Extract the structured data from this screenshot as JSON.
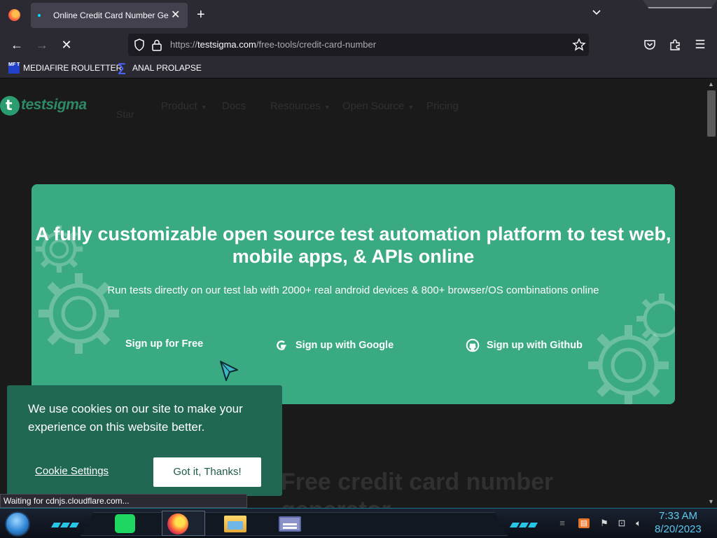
{
  "browser": {
    "tab_title": "Online Credit Card Number Ger",
    "url_domain": "testsigma.com",
    "url_path": "/free-tools/credit-card-number",
    "url_prefix": "https://",
    "bookmarks": [
      {
        "label": "MEDIAFIRE ROULETTER",
        "icon": "mediafire-icon"
      },
      {
        "label": "ANAL PROLAPSE",
        "icon": "bookmark-sigma-icon"
      }
    ],
    "status_text": "Waiting for cdnjs.cloudflare.com..."
  },
  "site": {
    "logo_text": "testsigma",
    "nav": [
      {
        "label": "Product",
        "dropdown": true
      },
      {
        "label": "Docs",
        "dropdown": false
      },
      {
        "label": "Resources",
        "dropdown": true
      },
      {
        "label": "Open Source",
        "dropdown": true
      },
      {
        "label": "Pricing",
        "dropdown": false
      }
    ],
    "nav_star": "Star",
    "hero": {
      "title": "A fully customizable open source test automation platform to test web, mobile apps, & APIs online",
      "subtitle": "Run tests directly on our test lab with 2000+ real android devices & 800+ browser/OS combinations online",
      "buttons": [
        {
          "label": "Sign up for Free",
          "icon": ""
        },
        {
          "label": "Sign up with Google",
          "icon": "google-icon"
        },
        {
          "label": "Sign up with Github",
          "icon": "github-icon"
        }
      ],
      "bg_color": "#3aaa82"
    },
    "section_title_line1": "Free credit card number",
    "section_title_line2": "generator"
  },
  "cookie": {
    "message": "We use cookies on our site to make your experience on this website better.",
    "settings_label": "Cookie Settings",
    "accept_label": "Got it, Thanks!",
    "bg_color": "#206853"
  },
  "taskbar": {
    "time": "7:33 AM",
    "date": "8/20/2023"
  }
}
